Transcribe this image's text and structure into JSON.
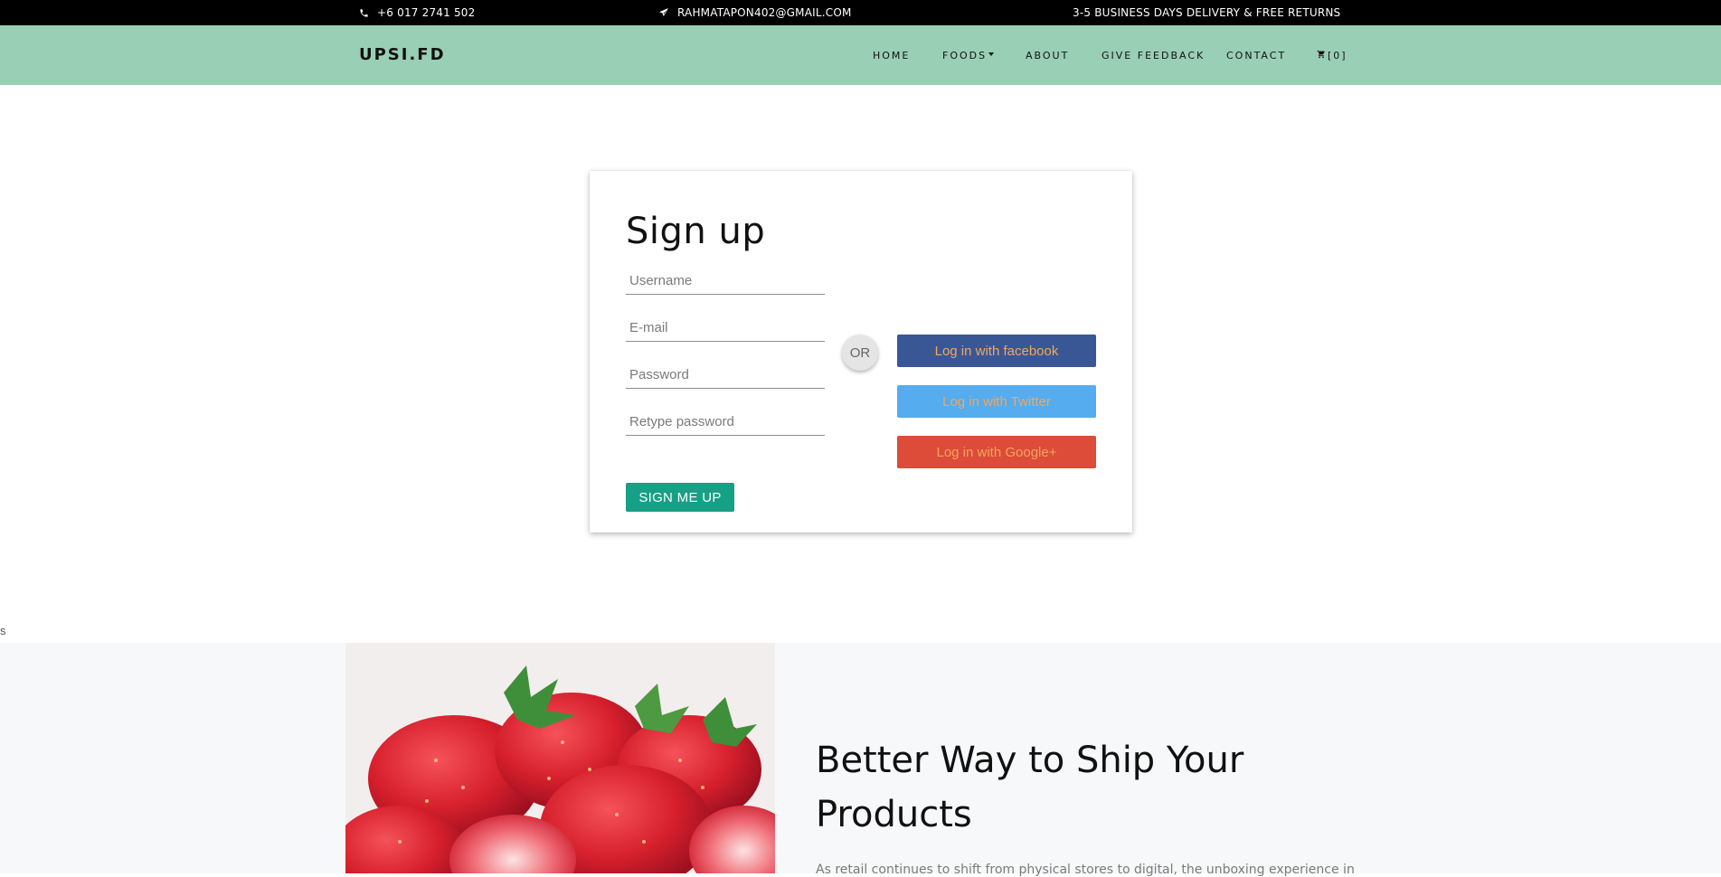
{
  "topbar": {
    "phone": "+6 017 2741 502",
    "email": "RAHMATAPON402@GMAIL.COM",
    "delivery": "3-5 BUSINESS DAYS DELIVERY & FREE RETURNS"
  },
  "navbar": {
    "brand": "UPSI.FD",
    "items": {
      "home": "HOME",
      "foods": "FOODS",
      "about": "ABOUT",
      "feedback": "GIVE FEEDBACK",
      "contact": "CONTACT",
      "cart": "[0]"
    }
  },
  "signup": {
    "title": "Sign up",
    "username_placeholder": "Username",
    "email_placeholder": "E-mail",
    "password_placeholder": "Password",
    "retype_placeholder": "Retype password",
    "submit_label": "SIGN ME UP",
    "or_label": "OR",
    "facebook_label": "Log in with facebook",
    "twitter_label": "Log in with Twitter",
    "google_label": "Log in with Google+"
  },
  "stray_text": "s",
  "feature": {
    "heading": "Better Way to Ship Your Products",
    "body": "As retail continues to shift from physical stores to digital, the unboxing experience in"
  },
  "colors": {
    "navbar_bg": "#99cfb4",
    "facebook": "#3a5795",
    "twitter": "#55acee",
    "google": "#dd4b39",
    "submit": "#16a085",
    "social_text": "#f2a65e"
  }
}
